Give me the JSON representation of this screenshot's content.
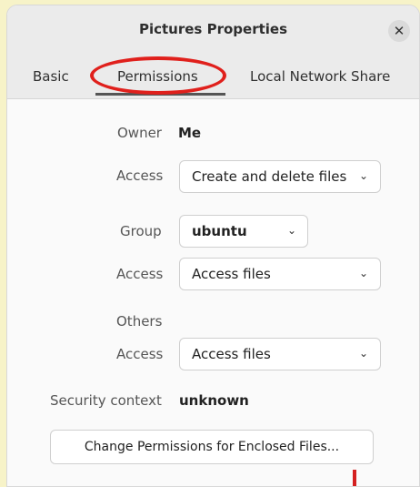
{
  "window": {
    "title": "Pictures Properties",
    "close_symbol": "✕"
  },
  "tabs": [
    {
      "label": "Basic",
      "selected": false
    },
    {
      "label": "Permissions",
      "selected": true
    },
    {
      "label": "Local Network Share",
      "selected": false
    }
  ],
  "owner": {
    "label": "Owner",
    "value": "Me",
    "access_label": "Access",
    "access_value": "Create and delete files"
  },
  "group": {
    "label": "Group",
    "value": "ubuntu",
    "access_label": "Access",
    "access_value": "Access files"
  },
  "others": {
    "label": "Others",
    "access_label": "Access",
    "access_value": "Access files"
  },
  "security": {
    "label": "Security context",
    "value": "unknown"
  },
  "enclosed_button": {
    "label": "Change Permissions for Enclosed Files..."
  },
  "icons": {
    "chevron": "chevron-down-icon",
    "close": "close-icon"
  },
  "colors": {
    "annotation": "#e0201c",
    "background": "#fafafa",
    "header": "#ebebeb"
  }
}
